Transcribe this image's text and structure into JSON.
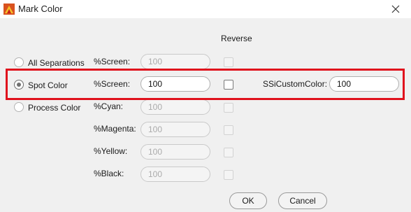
{
  "window": {
    "title": "Mark Color",
    "close_icon": "close-icon",
    "app_icon": "app-logo-icon"
  },
  "header": {
    "reverse": "Reverse"
  },
  "separations": [
    {
      "label": "All Separations",
      "selected": false
    },
    {
      "label": "Spot Color",
      "selected": true
    },
    {
      "label": "Process Color",
      "selected": false
    }
  ],
  "rows": [
    {
      "label": "%Screen:",
      "value": "100",
      "enabled": false
    },
    {
      "label": "%Screen:",
      "value": "100",
      "enabled": true
    },
    {
      "label": "%Cyan:",
      "value": "100",
      "enabled": false
    },
    {
      "label": "%Magenta:",
      "value": "100",
      "enabled": false
    },
    {
      "label": "%Yellow:",
      "value": "100",
      "enabled": false
    },
    {
      "label": "%Black:",
      "value": "100",
      "enabled": false
    }
  ],
  "custom": {
    "label": "SSiCustomColor:",
    "value": "100"
  },
  "buttons": {
    "ok": "OK",
    "cancel": "Cancel"
  },
  "colors": {
    "highlight": "#e0121d"
  }
}
